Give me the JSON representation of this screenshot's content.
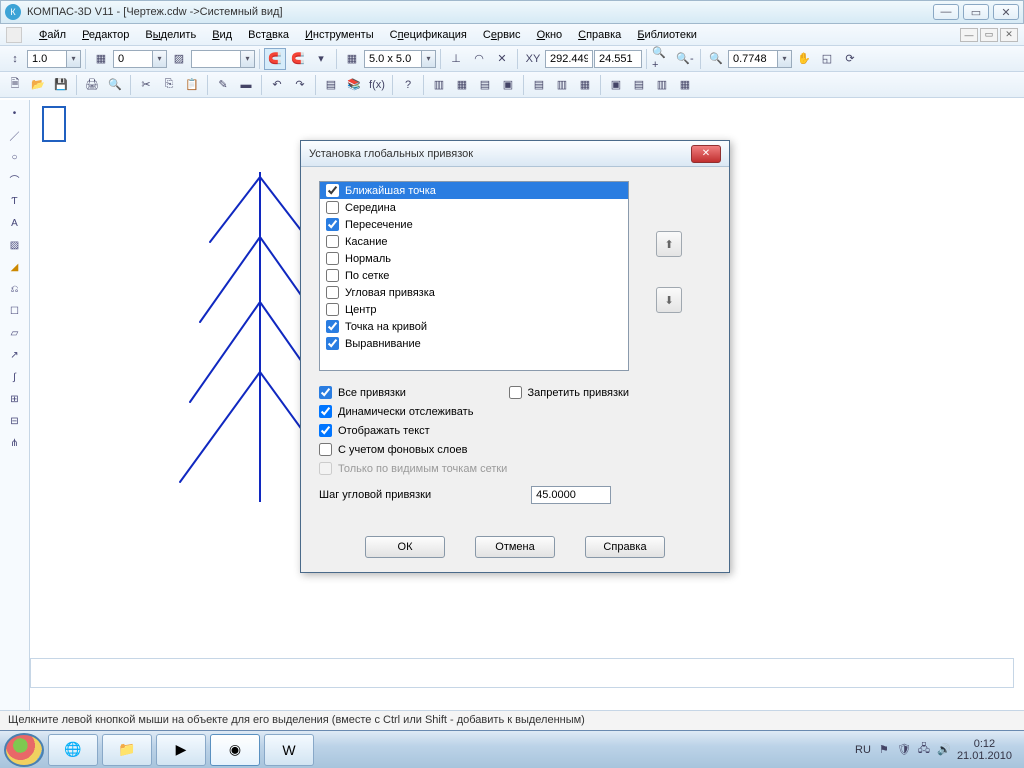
{
  "window": {
    "title": "КОМПАС-3D V11 - [Чертеж.cdw ->Системный вид]"
  },
  "menu": {
    "items": [
      "Файл",
      "Редактор",
      "Выделить",
      "Вид",
      "Вставка",
      "Инструменты",
      "Спецификация",
      "Сервис",
      "Окно",
      "Справка",
      "Библиотеки"
    ]
  },
  "toolbar1": {
    "combo1": "1.0",
    "combo2": "0",
    "grid": "5.0 x 5.0",
    "coordX": "292.449",
    "coordY": "24.551",
    "zoom": "0.7748"
  },
  "dialog": {
    "title": "Установка глобальных привязок",
    "items": [
      {
        "label": "Ближайшая точка",
        "checked": true,
        "selected": true
      },
      {
        "label": "Середина",
        "checked": false
      },
      {
        "label": "Пересечение",
        "checked": true
      },
      {
        "label": "Касание",
        "checked": false
      },
      {
        "label": "Нормаль",
        "checked": false
      },
      {
        "label": "По сетке",
        "checked": false
      },
      {
        "label": "Угловая привязка",
        "checked": false
      },
      {
        "label": "Центр",
        "checked": false
      },
      {
        "label": "Точка на кривой",
        "checked": true
      },
      {
        "label": "Выравнивание",
        "checked": true
      }
    ],
    "opt_all": "Все привязки",
    "opt_forbid": "Запретить привязки",
    "opt_dynamic": "Динамически отслеживать",
    "opt_showtext": "Отображать текст",
    "opt_bglayers": "С учетом фоновых слоев",
    "opt_gridonly": "Только по видимым точкам сетки",
    "step_label": "Шаг угловой привязки",
    "step_value": "45.0000",
    "btn_ok": "ОК",
    "btn_cancel": "Отмена",
    "btn_help": "Справка"
  },
  "status": "Щелкните левой кнопкой мыши на объекте для его выделения (вместе с Ctrl или Shift - добавить к выделенным)",
  "taskbar": {
    "time": "0:12",
    "date": "21.01.2010",
    "lang": "RU"
  }
}
